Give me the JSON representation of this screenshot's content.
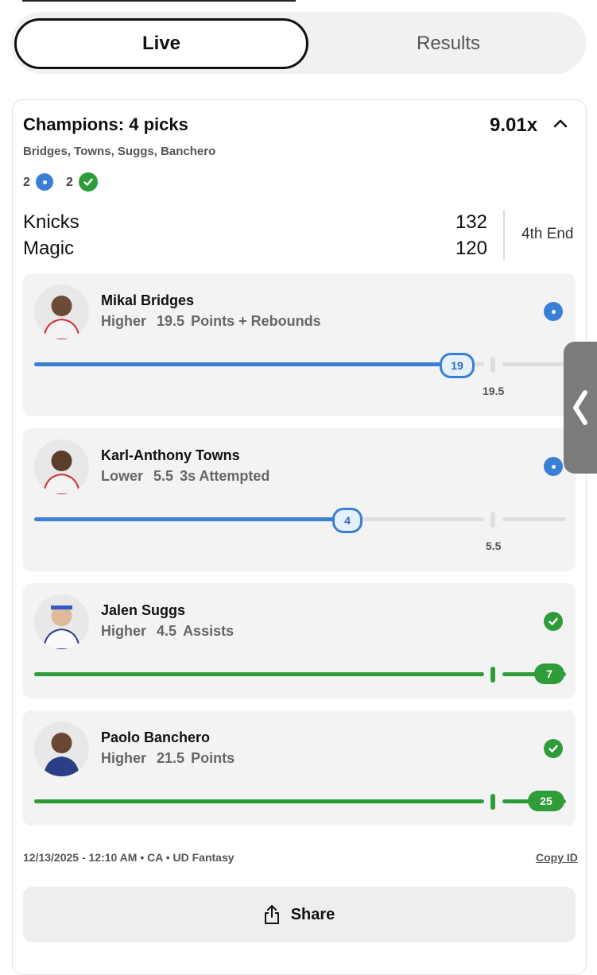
{
  "tabs": {
    "live": "Live",
    "results": "Results"
  },
  "entry": {
    "title": "Champions: 4 picks",
    "multiplier": "9.01x",
    "players": "Bridges, Towns, Suggs, Banchero",
    "live_count": "2",
    "won_count": "2"
  },
  "game": {
    "home_team": "Knicks",
    "home_score": "132",
    "away_team": "Magic",
    "away_score": "120",
    "period": "4th End"
  },
  "picks": [
    {
      "name": "Mikal Bridges",
      "direction": "Higher",
      "line": "19.5",
      "stat": "Points + Rebounds",
      "current": "19",
      "status": "live",
      "progress": 0.97
    },
    {
      "name": "Karl-Anthony Towns",
      "direction": "Lower",
      "line": "5.5",
      "stat": "3s Attempted",
      "current": "4",
      "status": "live",
      "progress": 0.73
    },
    {
      "name": "Jalen Suggs",
      "direction": "Higher",
      "line": "4.5",
      "stat": "Assists",
      "current": "7",
      "status": "won",
      "progress": 1.0
    },
    {
      "name": "Paolo Banchero",
      "direction": "Higher",
      "line": "21.5",
      "stat": "Points",
      "current": "25",
      "status": "won",
      "progress": 1.0
    }
  ],
  "footer": {
    "meta": "12/13/2025 - 12:10 AM • CA • UD Fantasy",
    "copy_id": "Copy ID",
    "share": "Share"
  },
  "colors": {
    "live": "#3a7fd6",
    "won": "#2e9c39",
    "track": "#dedede"
  },
  "icons": [
    "chevron-up-icon",
    "live-dot-icon",
    "check-icon",
    "share-icon",
    "chevron-left-icon"
  ]
}
